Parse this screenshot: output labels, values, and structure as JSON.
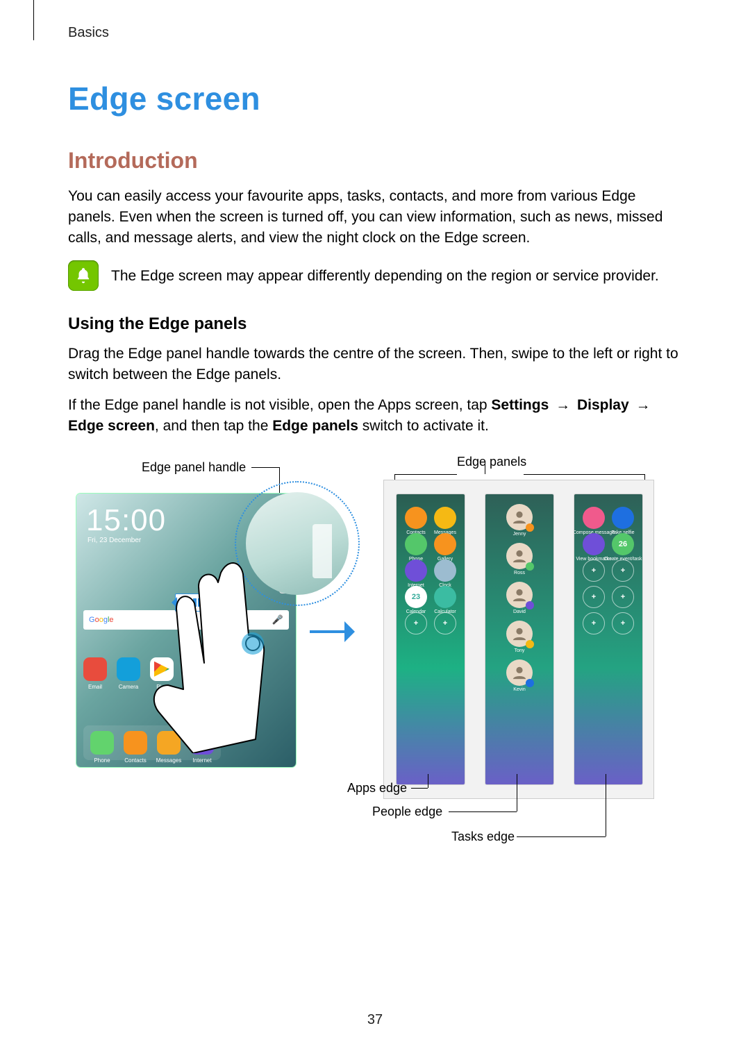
{
  "chapter": "Basics",
  "title": "Edge screen",
  "section": "Introduction",
  "intro_paragraph": "You can easily access your favourite apps, tasks, contacts, and more from various Edge panels. Even when the screen is turned off, you can view information, such as news, missed calls, and message alerts, and view the night clock on the Edge screen.",
  "note": "The Edge screen may appear differently depending on the region or service provider.",
  "subhead": "Using the Edge panels",
  "para1": "Drag the Edge panel handle towards the centre of the screen. Then, swipe to the left or right to switch between the Edge panels.",
  "nav": {
    "pre": "If the Edge panel handle is not visible, open the Apps screen, tap ",
    "step1": "Settings",
    "step2": "Display",
    "step3": "Edge screen",
    "mid": ", and then tap the ",
    "step4": "Edge panels",
    "post": " switch to activate it.",
    "arrow": "→"
  },
  "callouts": {
    "handle": "Edge panel handle",
    "panels": "Edge panels",
    "apps_edge": "Apps edge",
    "people_edge": "People edge",
    "tasks_edge": "Tasks edge"
  },
  "phone": {
    "time": "15:00",
    "date": "Fri, 23 December",
    "search_brand": "Google",
    "row1": [
      {
        "label": "Email",
        "cls": "ic-email"
      },
      {
        "label": "Camera",
        "cls": "ic-camera"
      },
      {
        "label": "Play",
        "cls": "ic-play"
      }
    ],
    "dock": [
      {
        "label": "Phone",
        "cls": "ic-phone"
      },
      {
        "label": "Contacts",
        "cls": "ic-contacts"
      },
      {
        "label": "Messages",
        "cls": "ic-msgs"
      },
      {
        "label": "Internet",
        "cls": "ic-internet"
      }
    ]
  },
  "apps_panel": [
    {
      "label": "Contacts",
      "cls": "c-orange"
    },
    {
      "label": "Messages",
      "cls": "c-yellow"
    },
    {
      "label": "Phone",
      "cls": "c-green"
    },
    {
      "label": "Gallery",
      "cls": "c-star"
    },
    {
      "label": "Internet",
      "cls": "c-globe"
    },
    {
      "label": "Clock",
      "cls": "c-clock"
    },
    {
      "label": "Calendar",
      "cls": "c-cal",
      "text": "23"
    },
    {
      "label": "Calculator",
      "cls": "c-calc"
    },
    {
      "label": "",
      "cls": "add",
      "text": "+"
    },
    {
      "label": "",
      "cls": "add",
      "text": "+"
    }
  ],
  "people_panel": [
    {
      "label": "Jenny",
      "badge": "b-or"
    },
    {
      "label": "Ross",
      "badge": "b-gr"
    },
    {
      "label": "David",
      "badge": "b-pu"
    },
    {
      "label": "Tony",
      "badge": "b-ye"
    },
    {
      "label": "Kevin",
      "badge": "b-bl"
    }
  ],
  "tasks_panel": [
    {
      "label": "Compose message",
      "cls": "c-pink"
    },
    {
      "label": "Take selfie",
      "cls": "c-blue"
    },
    {
      "label": "View bookmarks",
      "cls": "c-purple"
    },
    {
      "label": "Create event/task",
      "cls": "c-green",
      "text": "26"
    },
    {
      "label": "",
      "cls": "add",
      "text": "+"
    },
    {
      "label": "",
      "cls": "add",
      "text": "+"
    },
    {
      "label": "",
      "cls": "add",
      "text": "+"
    },
    {
      "label": "",
      "cls": "add",
      "text": "+"
    },
    {
      "label": "",
      "cls": "add",
      "text": "+"
    },
    {
      "label": "",
      "cls": "add",
      "text": "+"
    }
  ],
  "page_number": "37"
}
